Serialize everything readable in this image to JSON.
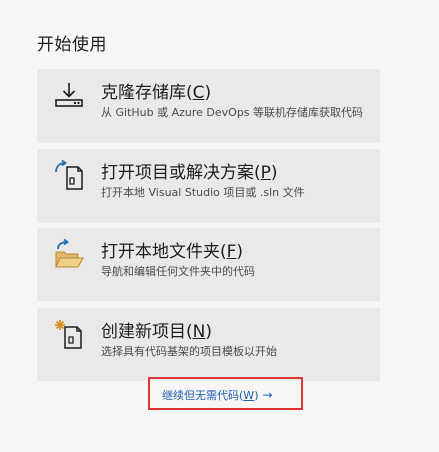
{
  "section_title": "开始使用",
  "cards": {
    "clone": {
      "title_prefix": "克隆存储库(",
      "title_key": "C",
      "title_suffix": ")",
      "description": "从 GitHub 或 Azure DevOps 等联机存储库获取代码",
      "icon": "download-icon"
    },
    "open_project": {
      "title_prefix": "打开项目或解决方案(",
      "title_key": "P",
      "title_suffix": ")",
      "description": "打开本地 Visual Studio 项目或 .sln 文件",
      "icon": "open-project-icon"
    },
    "open_folder": {
      "title_prefix": "打开本地文件夹(",
      "title_key": "F",
      "title_suffix": ")",
      "description": "导航和编辑任何文件夹中的代码",
      "icon": "open-folder-icon"
    },
    "new_project": {
      "title_prefix": "创建新项目(",
      "title_key": "N",
      "title_suffix": ")",
      "description": "选择具有代码基架的项目模板以开始",
      "icon": "new-project-icon"
    }
  },
  "continue": {
    "prefix": "继续但无需代码(",
    "key": "W",
    "suffix": ")",
    "arrow": "→"
  },
  "colors": {
    "highlight_border": "#e03333",
    "link": "#1a5fb4",
    "icon_blue": "#1f6fb8",
    "folder": "#e0b86a"
  }
}
